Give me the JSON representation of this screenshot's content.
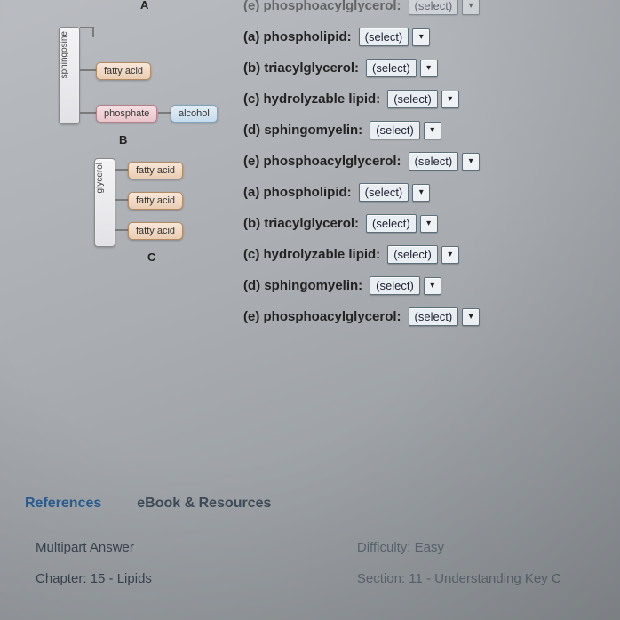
{
  "top_clipped": {
    "label": "(e) phosphoacylglycerol:",
    "value": "(select)"
  },
  "diagrams": {
    "labels": {
      "A": "A",
      "B": "B",
      "C": "C"
    },
    "sphingosine": "sphingosine",
    "glycerol": "glycerol",
    "fatty_acid": "fatty acid",
    "phosphate": "phosphate",
    "alcohol": "alcohol"
  },
  "groups": [
    {
      "items": [
        {
          "key": "a",
          "label": "(a) phospholipid:",
          "value": "(select)"
        },
        {
          "key": "b",
          "label": "(b) triacylglycerol:",
          "value": "(select)"
        },
        {
          "key": "c",
          "label": "(c) hydrolyzable lipid:",
          "value": "(select)"
        },
        {
          "key": "d",
          "label": "(d) sphingomyelin:",
          "value": "(select)"
        },
        {
          "key": "e",
          "label": "(e) phosphoacylglycerol:",
          "value": "(select)"
        }
      ]
    },
    {
      "items": [
        {
          "key": "a",
          "label": "(a) phospholipid:",
          "value": "(select)"
        },
        {
          "key": "b",
          "label": "(b) triacylglycerol:",
          "value": "(select)"
        },
        {
          "key": "c",
          "label": "(c) hydrolyzable lipid:",
          "value": "(select)"
        },
        {
          "key": "d",
          "label": "(d) sphingomyelin:",
          "value": "(select)"
        },
        {
          "key": "e",
          "label": "(e) phosphoacylglycerol:",
          "value": "(select)"
        }
      ]
    }
  ],
  "tabs": {
    "references": "References",
    "ebook": "eBook & Resources"
  },
  "meta": {
    "multipart": "Multipart Answer",
    "difficulty": "Difficulty: Easy",
    "chapter": "Chapter: 15 - Lipids",
    "section": "Section: 11 - Understanding Key C"
  },
  "glyphs": {
    "caret": "▾"
  }
}
